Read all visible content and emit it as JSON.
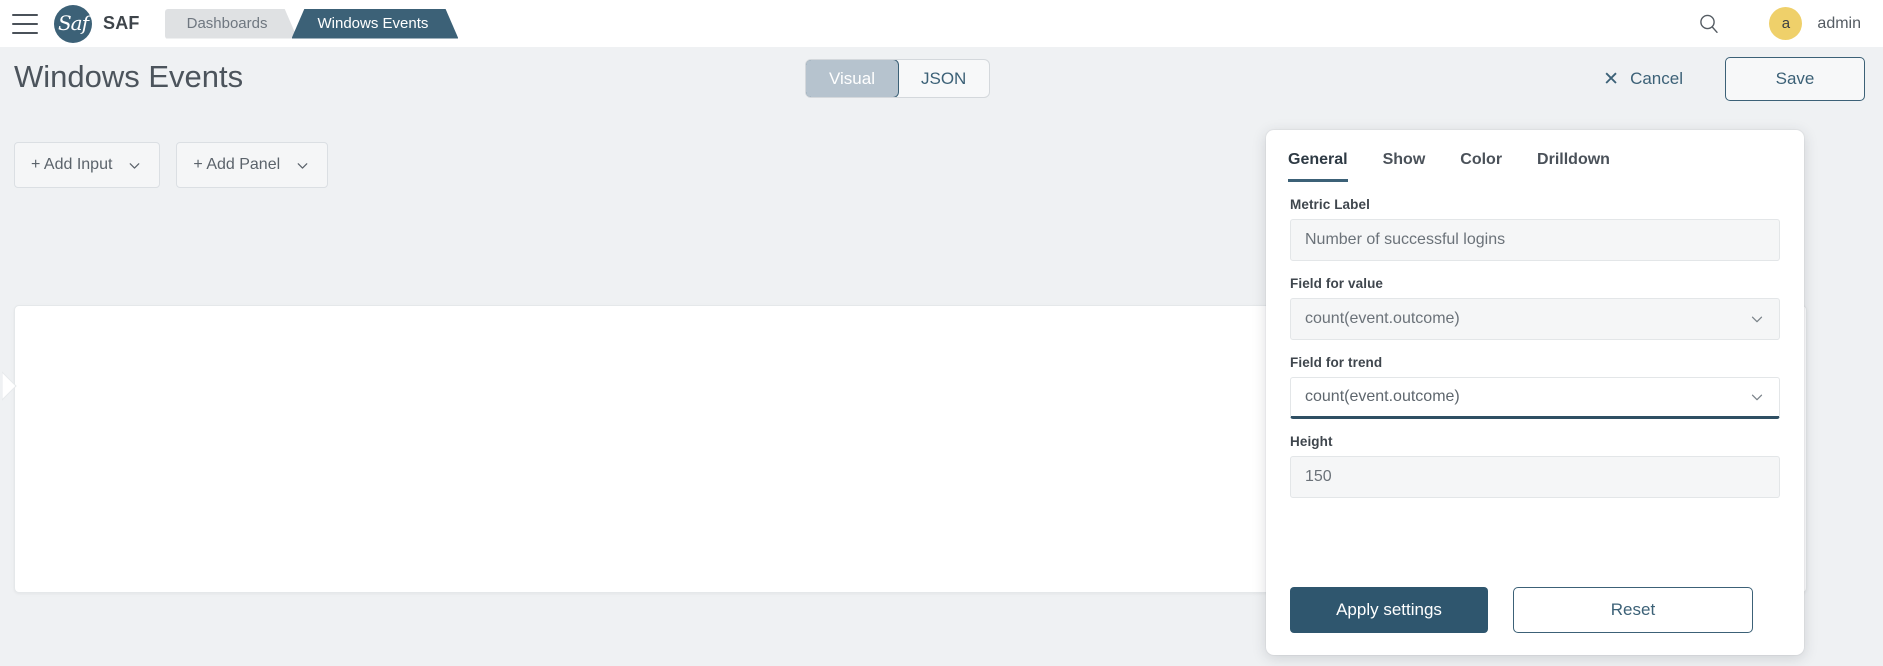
{
  "topnav": {
    "menu_icon": "hamburger-icon",
    "logo_glyph": "Saf",
    "brand": "SAF",
    "breadcrumbs": [
      {
        "label": "Dashboards",
        "active": false
      },
      {
        "label": "Windows Events",
        "active": true
      }
    ],
    "search_icon": "search-icon",
    "avatar_initial": "a",
    "username": "admin"
  },
  "header": {
    "title": "Windows Events",
    "view_modes": [
      {
        "label": "Visual",
        "selected": true
      },
      {
        "label": "JSON",
        "selected": false
      }
    ],
    "cancel_label": "Cancel",
    "cancel_icon": "close-icon",
    "save_label": "Save"
  },
  "toolbar": {
    "add_input_label": "+ Add Input",
    "add_panel_label": "+ Add Panel",
    "chevron_icon": "chevron-down-icon"
  },
  "panel_card": {
    "drag_icon": "drag-handle-icon",
    "close_icon": "close-icon",
    "edit_icon": "edit-square-icon",
    "caret_icon": "chevron-right-icon"
  },
  "settings": {
    "tabs": [
      {
        "label": "General",
        "active": true
      },
      {
        "label": "Show",
        "active": false
      },
      {
        "label": "Color",
        "active": false
      },
      {
        "label": "Drilldown",
        "active": false
      }
    ],
    "fields": [
      {
        "label": "Metric Label",
        "value": "Number of successful logins",
        "type": "text",
        "focused": false
      },
      {
        "label": "Field for value",
        "value": "count(event.outcome)",
        "type": "select",
        "focused": false,
        "chevron_icon": "chevron-down-icon"
      },
      {
        "label": "Field for trend",
        "value": "count(event.outcome)",
        "type": "select",
        "focused": true,
        "chevron_icon": "chevron-down-icon"
      },
      {
        "label": "Height",
        "value": "150",
        "type": "text",
        "focused": false
      }
    ],
    "apply_label": "Apply settings",
    "reset_label": "Reset"
  },
  "colors": {
    "brand_blue": "#3c6177",
    "accent_dark": "#2f566e",
    "avatar_yellow": "#efd06a",
    "page_bg": "#eff1f3",
    "segment_on": "#b6c3ce"
  }
}
